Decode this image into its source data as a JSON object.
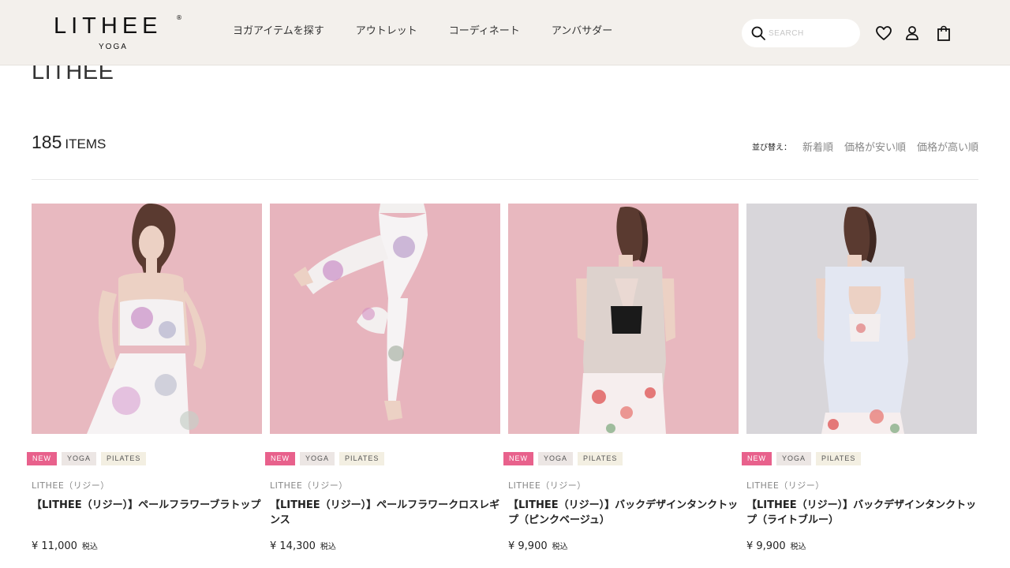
{
  "header": {
    "logo_text": "LITHEE",
    "logo_sub": "YOGA",
    "nav": [
      {
        "label": "ヨガアイテムを探す"
      },
      {
        "label": "アウトレット"
      },
      {
        "label": "コーディネート"
      },
      {
        "label": "アンバサダー"
      }
    ],
    "search_placeholder": "SEARCH",
    "icons": [
      "search-icon",
      "heart-icon",
      "user-icon",
      "bag-icon"
    ]
  },
  "page": {
    "brand_title": "LITHEE",
    "count_number": "185",
    "count_label": "ITEMS",
    "sort_label": "並び替え：",
    "sort_options": [
      "新着順",
      "価格が安い順",
      "価格が高い順"
    ]
  },
  "products": [
    {
      "tags": [
        "NEW",
        "YOGA",
        "PILATES"
      ],
      "brand": "LITHEE（リジー）",
      "name": "【LITHEE（リジー）】ペールフラワーブラトップ",
      "price": "¥ 11,000",
      "tax": "税込",
      "image_bg": "#e8b9c0"
    },
    {
      "tags": [
        "NEW",
        "YOGA",
        "PILATES"
      ],
      "brand": "LITHEE（リジー）",
      "name": "【LITHEE（リジー）】ペールフラワークロスレギンス",
      "price": "¥ 14,300",
      "tax": "税込",
      "image_bg": "#e7b4bd"
    },
    {
      "tags": [
        "NEW",
        "YOGA",
        "PILATES"
      ],
      "brand": "LITHEE（リジー）",
      "name": "【LITHEE（リジー）】バックデザインタンクトップ（ピンクベージュ）",
      "price": "¥ 9,900",
      "tax": "税込",
      "image_bg": "#e8b8bf"
    },
    {
      "tags": [
        "NEW",
        "YOGA",
        "PILATES"
      ],
      "brand": "LITHEE（リジー）",
      "name": "【LITHEE（リジー）】バックデザインタンクトップ（ライトブルー）",
      "price": "¥ 9,900",
      "tax": "税込",
      "image_bg": "#d8d6da"
    }
  ],
  "colors": {
    "header_bg": "#f3f0ec",
    "tag_new": "#e8618c",
    "tag_yoga": "#ece6e4",
    "tag_pilates": "#f3efe2"
  }
}
